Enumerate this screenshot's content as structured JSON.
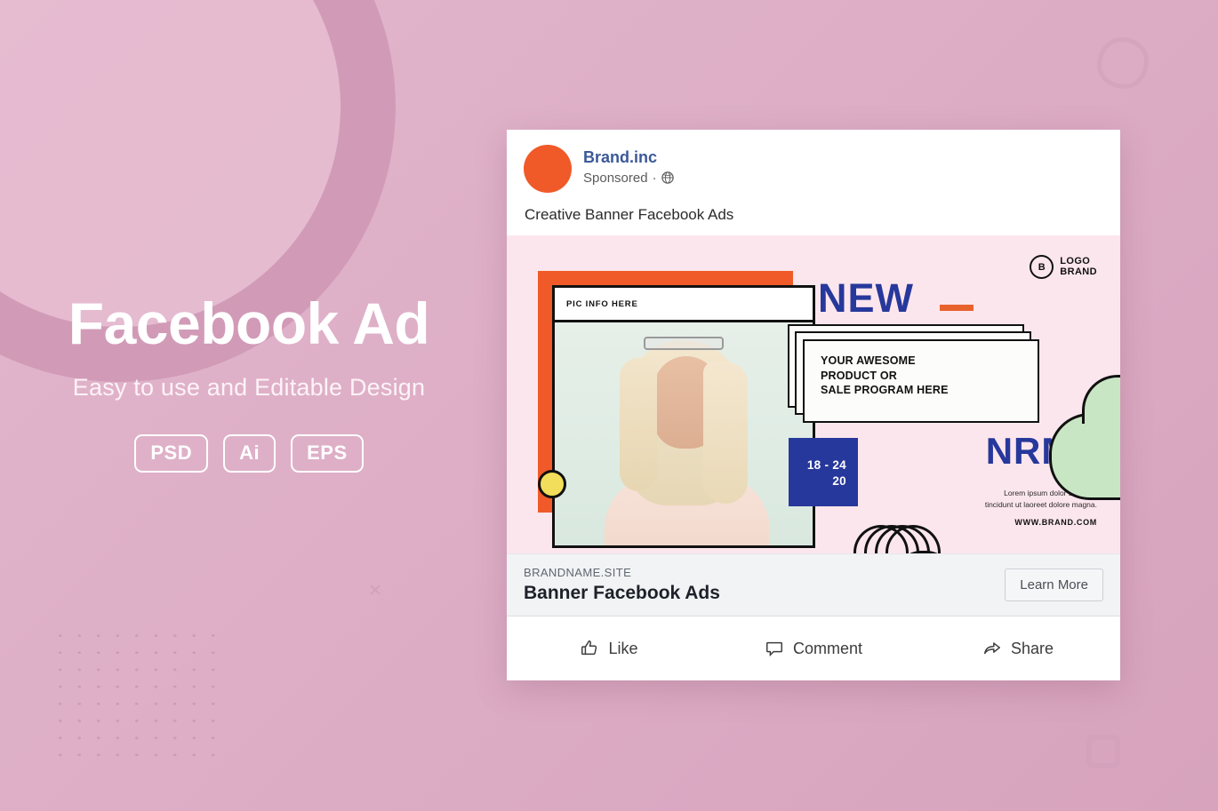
{
  "promo": {
    "title": "Facebook Ad",
    "subtitle": "Easy to use and Editable Design",
    "badges": [
      "PSD",
      "Ai",
      "EPS"
    ]
  },
  "post": {
    "brand_name": "Brand.inc",
    "sponsored_label": "Sponsored",
    "separator": "·",
    "globe_icon": "globe-icon",
    "caption": "Creative Banner Facebook Ads"
  },
  "creative": {
    "pic_info_label": "PIC INFO HERE",
    "logo_mark": "B",
    "logo_line1": "LOGO",
    "logo_line2": "BRAND",
    "new_word": "NEW",
    "card_line1": "YOUR AWESOME",
    "card_line2": "PRODUCT OR",
    "card_line3": "SALE PROGRAM HERE",
    "date_range": "18 - 24",
    "date_year": "20",
    "nrml": "NRML",
    "lorem_line1": "Lorem ipsum dolor sit amet.",
    "lorem_line2": "tincidunt ut laoreet dolore magna.",
    "website": "WWW.BRAND.COM"
  },
  "cta": {
    "domain": "BRANDNAME.SITE",
    "headline": "Banner Facebook Ads",
    "button_label": "Learn More"
  },
  "actions": [
    {
      "label": "Like",
      "icon": "thumbs-up-icon"
    },
    {
      "label": "Comment",
      "icon": "comment-bubble-icon"
    },
    {
      "label": "Share",
      "icon": "share-arrow-icon"
    }
  ],
  "colors": {
    "background_pink": "#ddaec6",
    "brand_orange": "#f05a28",
    "brand_blue": "#27389c",
    "link_blue": "#3b5998",
    "creative_bg": "#fce6ed",
    "blob_green": "#c9e6c4",
    "accent_yellow": "#f2de5a"
  }
}
